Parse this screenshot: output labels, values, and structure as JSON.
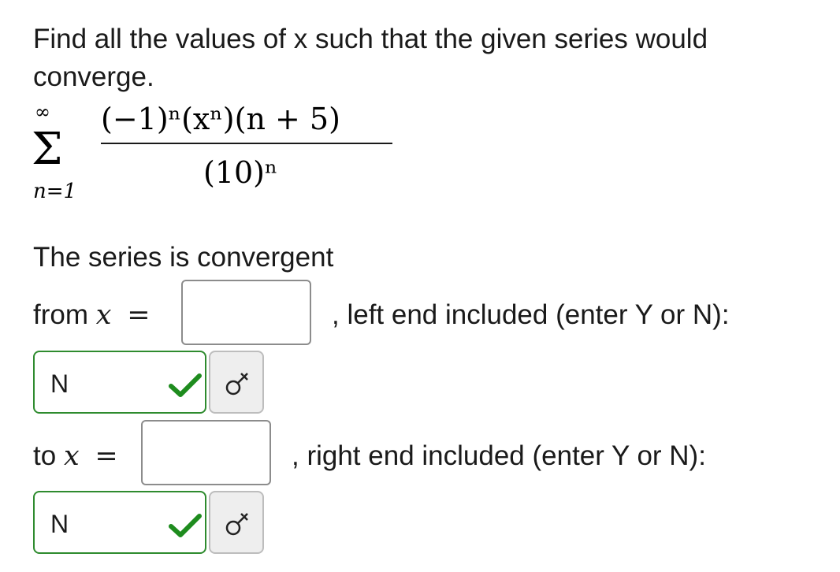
{
  "question": {
    "text": "Find all the values of x such that the given series would converge."
  },
  "formula": {
    "sum_upper": "∞",
    "sum_lower": "n=1",
    "numerator": "(−1)ⁿ(xⁿ)(n + 5)",
    "denominator": "(10)ⁿ"
  },
  "answer": {
    "convergent_label": "The series is convergent",
    "from_prefix": "from",
    "to_prefix": "to",
    "variable": "x",
    "equals": "=",
    "left_suffix": ", left end included (enter Y or N):",
    "right_suffix": ", right end included (enter Y or N):",
    "from_value": "",
    "to_value": "",
    "left_included": "N",
    "right_included": "N"
  },
  "icons": {
    "check": "check-icon",
    "key": "key-icon"
  },
  "colors": {
    "correct_border": "#2e8b2e",
    "check": "#1e8c1e",
    "key_button_bg": "#eeeeee"
  }
}
